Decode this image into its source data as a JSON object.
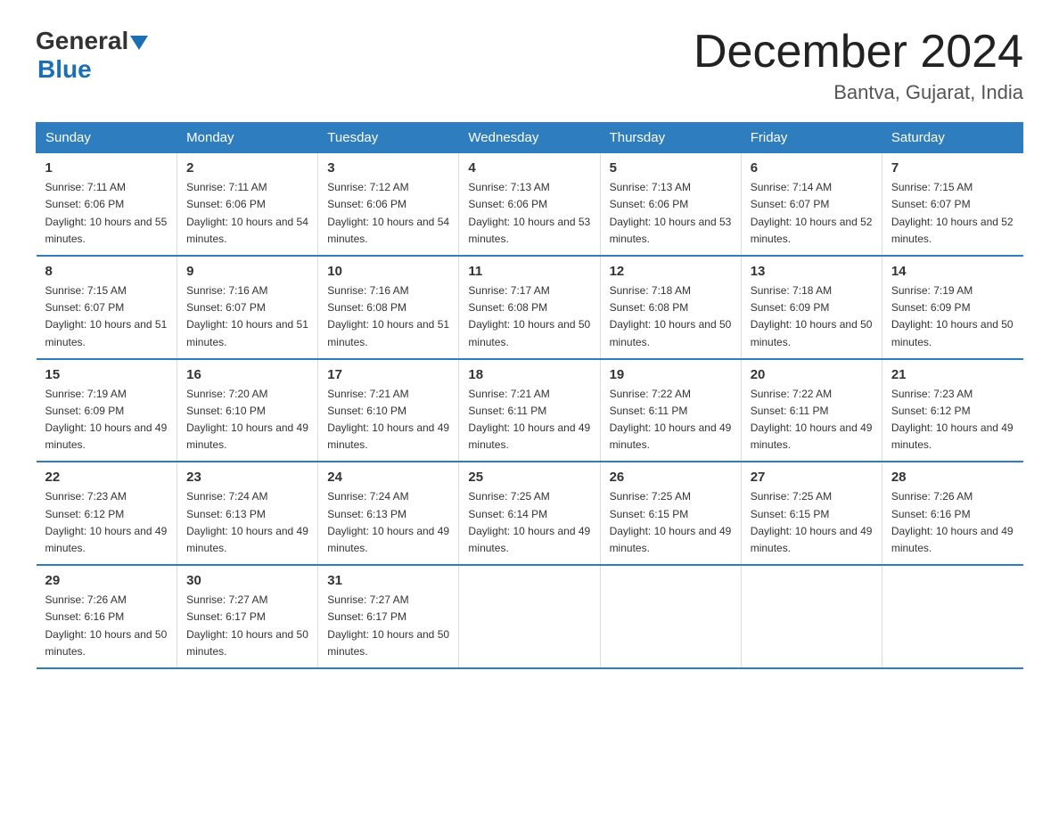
{
  "header": {
    "logo_general": "General",
    "logo_blue": "Blue",
    "month_title": "December 2024",
    "location": "Bantva, Gujarat, India"
  },
  "weekdays": [
    "Sunday",
    "Monday",
    "Tuesday",
    "Wednesday",
    "Thursday",
    "Friday",
    "Saturday"
  ],
  "weeks": [
    [
      {
        "day": "1",
        "sunrise": "7:11 AM",
        "sunset": "6:06 PM",
        "daylight": "10 hours and 55 minutes."
      },
      {
        "day": "2",
        "sunrise": "7:11 AM",
        "sunset": "6:06 PM",
        "daylight": "10 hours and 54 minutes."
      },
      {
        "day": "3",
        "sunrise": "7:12 AM",
        "sunset": "6:06 PM",
        "daylight": "10 hours and 54 minutes."
      },
      {
        "day": "4",
        "sunrise": "7:13 AM",
        "sunset": "6:06 PM",
        "daylight": "10 hours and 53 minutes."
      },
      {
        "day": "5",
        "sunrise": "7:13 AM",
        "sunset": "6:06 PM",
        "daylight": "10 hours and 53 minutes."
      },
      {
        "day": "6",
        "sunrise": "7:14 AM",
        "sunset": "6:07 PM",
        "daylight": "10 hours and 52 minutes."
      },
      {
        "day": "7",
        "sunrise": "7:15 AM",
        "sunset": "6:07 PM",
        "daylight": "10 hours and 52 minutes."
      }
    ],
    [
      {
        "day": "8",
        "sunrise": "7:15 AM",
        "sunset": "6:07 PM",
        "daylight": "10 hours and 51 minutes."
      },
      {
        "day": "9",
        "sunrise": "7:16 AM",
        "sunset": "6:07 PM",
        "daylight": "10 hours and 51 minutes."
      },
      {
        "day": "10",
        "sunrise": "7:16 AM",
        "sunset": "6:08 PM",
        "daylight": "10 hours and 51 minutes."
      },
      {
        "day": "11",
        "sunrise": "7:17 AM",
        "sunset": "6:08 PM",
        "daylight": "10 hours and 50 minutes."
      },
      {
        "day": "12",
        "sunrise": "7:18 AM",
        "sunset": "6:08 PM",
        "daylight": "10 hours and 50 minutes."
      },
      {
        "day": "13",
        "sunrise": "7:18 AM",
        "sunset": "6:09 PM",
        "daylight": "10 hours and 50 minutes."
      },
      {
        "day": "14",
        "sunrise": "7:19 AM",
        "sunset": "6:09 PM",
        "daylight": "10 hours and 50 minutes."
      }
    ],
    [
      {
        "day": "15",
        "sunrise": "7:19 AM",
        "sunset": "6:09 PM",
        "daylight": "10 hours and 49 minutes."
      },
      {
        "day": "16",
        "sunrise": "7:20 AM",
        "sunset": "6:10 PM",
        "daylight": "10 hours and 49 minutes."
      },
      {
        "day": "17",
        "sunrise": "7:21 AM",
        "sunset": "6:10 PM",
        "daylight": "10 hours and 49 minutes."
      },
      {
        "day": "18",
        "sunrise": "7:21 AM",
        "sunset": "6:11 PM",
        "daylight": "10 hours and 49 minutes."
      },
      {
        "day": "19",
        "sunrise": "7:22 AM",
        "sunset": "6:11 PM",
        "daylight": "10 hours and 49 minutes."
      },
      {
        "day": "20",
        "sunrise": "7:22 AM",
        "sunset": "6:11 PM",
        "daylight": "10 hours and 49 minutes."
      },
      {
        "day": "21",
        "sunrise": "7:23 AM",
        "sunset": "6:12 PM",
        "daylight": "10 hours and 49 minutes."
      }
    ],
    [
      {
        "day": "22",
        "sunrise": "7:23 AM",
        "sunset": "6:12 PM",
        "daylight": "10 hours and 49 minutes."
      },
      {
        "day": "23",
        "sunrise": "7:24 AM",
        "sunset": "6:13 PM",
        "daylight": "10 hours and 49 minutes."
      },
      {
        "day": "24",
        "sunrise": "7:24 AM",
        "sunset": "6:13 PM",
        "daylight": "10 hours and 49 minutes."
      },
      {
        "day": "25",
        "sunrise": "7:25 AM",
        "sunset": "6:14 PM",
        "daylight": "10 hours and 49 minutes."
      },
      {
        "day": "26",
        "sunrise": "7:25 AM",
        "sunset": "6:15 PM",
        "daylight": "10 hours and 49 minutes."
      },
      {
        "day": "27",
        "sunrise": "7:25 AM",
        "sunset": "6:15 PM",
        "daylight": "10 hours and 49 minutes."
      },
      {
        "day": "28",
        "sunrise": "7:26 AM",
        "sunset": "6:16 PM",
        "daylight": "10 hours and 49 minutes."
      }
    ],
    [
      {
        "day": "29",
        "sunrise": "7:26 AM",
        "sunset": "6:16 PM",
        "daylight": "10 hours and 50 minutes."
      },
      {
        "day": "30",
        "sunrise": "7:27 AM",
        "sunset": "6:17 PM",
        "daylight": "10 hours and 50 minutes."
      },
      {
        "day": "31",
        "sunrise": "7:27 AM",
        "sunset": "6:17 PM",
        "daylight": "10 hours and 50 minutes."
      },
      {
        "day": "",
        "sunrise": "",
        "sunset": "",
        "daylight": ""
      },
      {
        "day": "",
        "sunrise": "",
        "sunset": "",
        "daylight": ""
      },
      {
        "day": "",
        "sunrise": "",
        "sunset": "",
        "daylight": ""
      },
      {
        "day": "",
        "sunrise": "",
        "sunset": "",
        "daylight": ""
      }
    ]
  ]
}
